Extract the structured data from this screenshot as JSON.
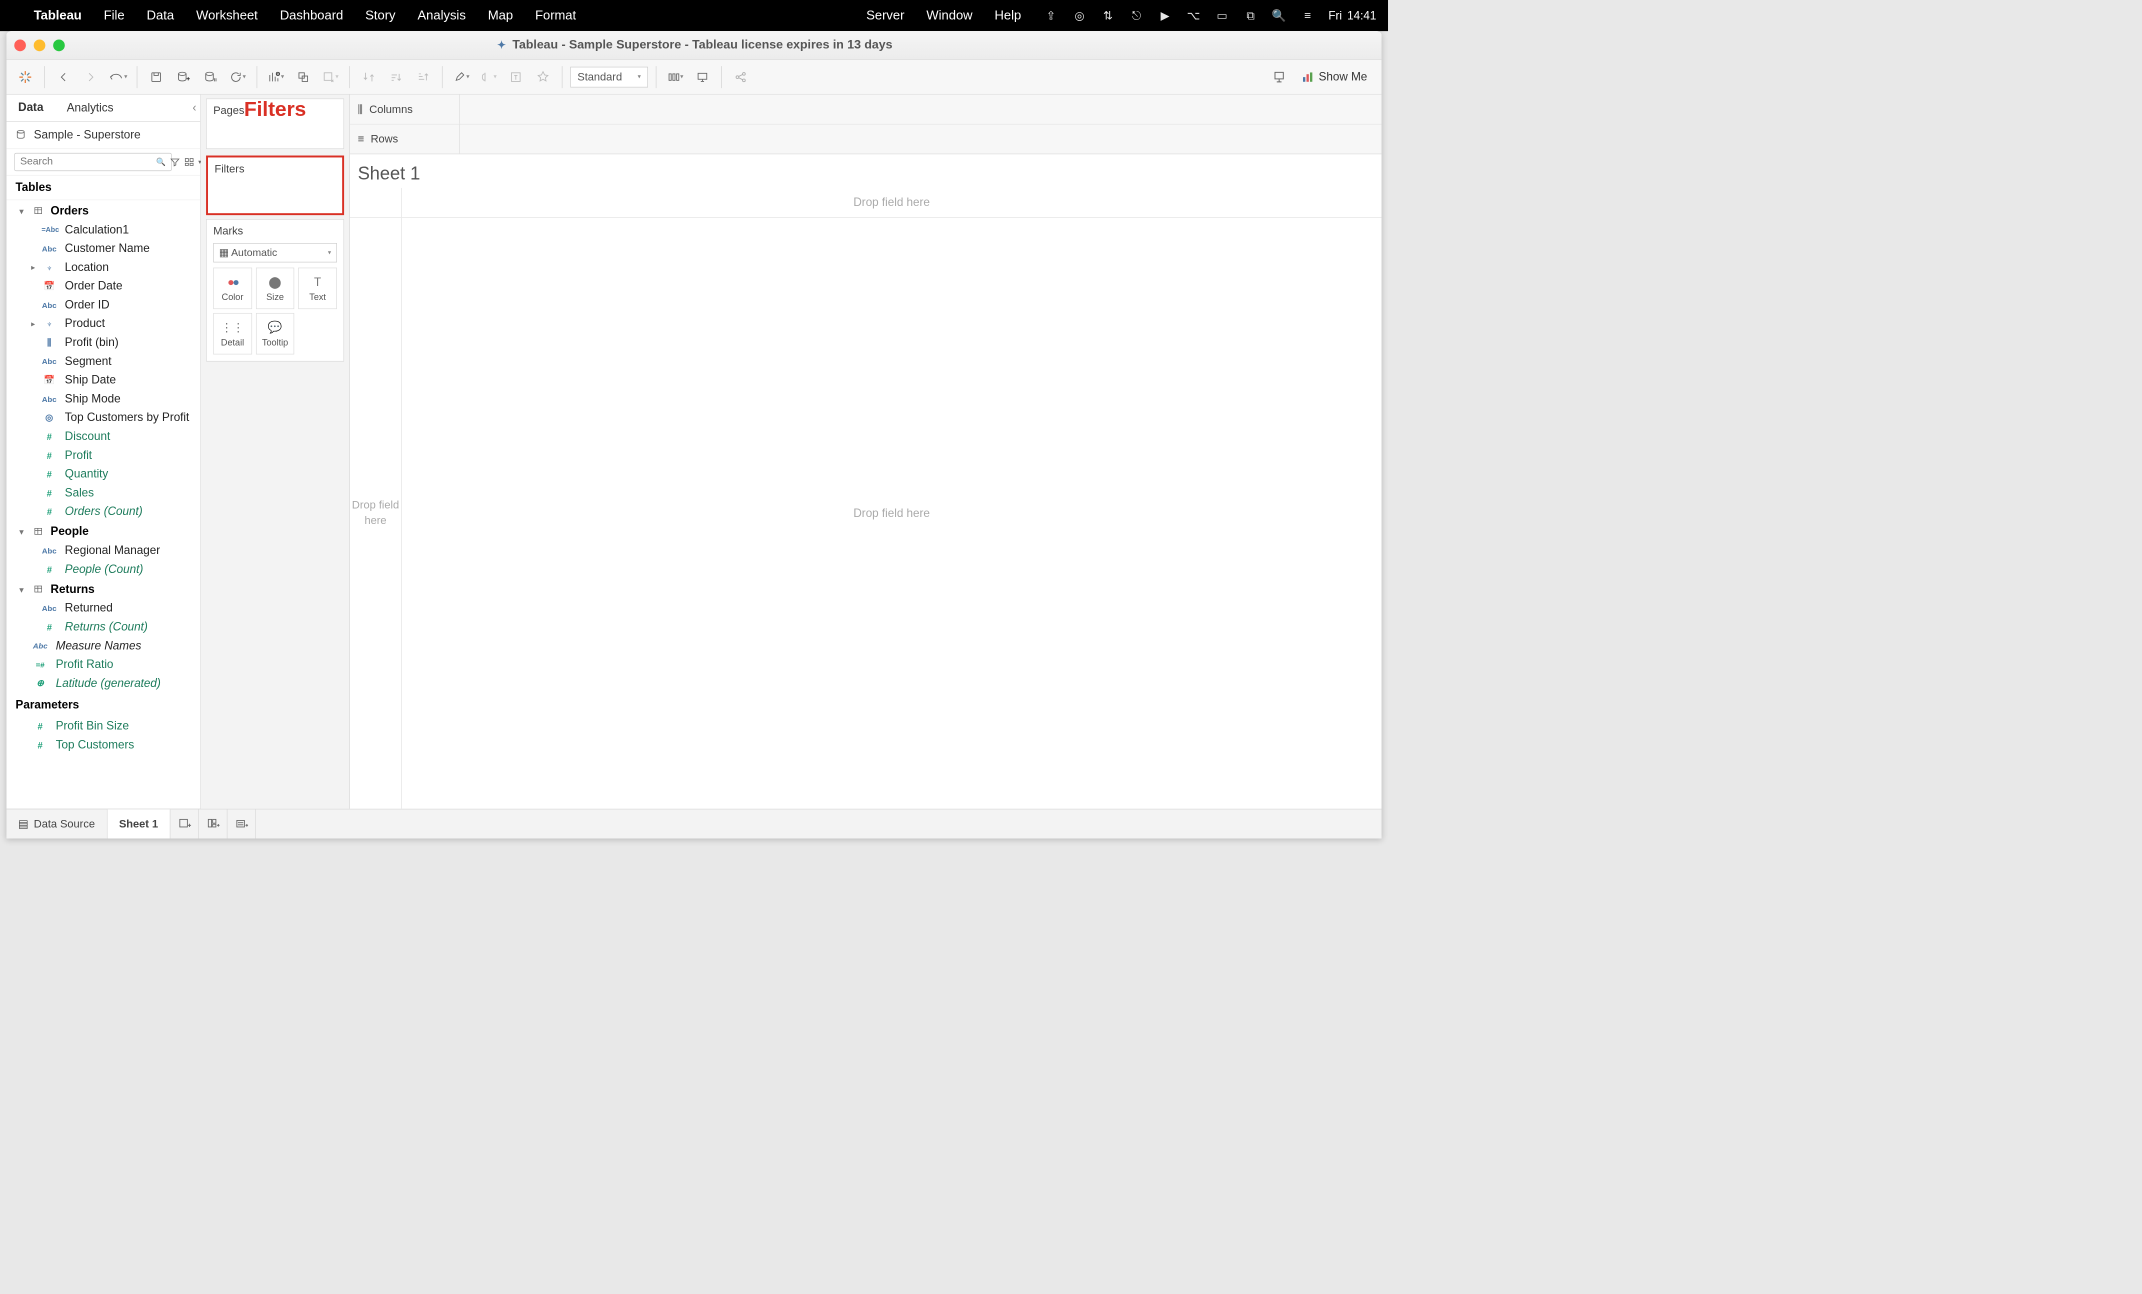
{
  "menubar": {
    "app": "Tableau",
    "items": [
      "File",
      "Data",
      "Worksheet",
      "Dashboard",
      "Story",
      "Analysis",
      "Map",
      "Format"
    ],
    "right_items": [
      "Server",
      "Window",
      "Help"
    ],
    "clock_day": "Fri",
    "clock_time": "14:41"
  },
  "window": {
    "title": "Tableau - Sample Superstore - Tableau license expires in 13 days"
  },
  "toolbar": {
    "fit": "Standard",
    "showme": "Show Me"
  },
  "data_pane": {
    "tabs": [
      "Data",
      "Analytics"
    ],
    "datasource": "Sample - Superstore",
    "search_placeholder": "Search",
    "tables_label": "Tables",
    "params_label": "Parameters",
    "tables": [
      {
        "name": "Orders",
        "fields": [
          {
            "label": "Calculation1",
            "icon": "=Abc",
            "kind": "dim"
          },
          {
            "label": "Customer Name",
            "icon": "Abc",
            "kind": "dim"
          },
          {
            "label": "Location",
            "icon": "hier",
            "kind": "dim",
            "expandable": true
          },
          {
            "label": "Order Date",
            "icon": "date",
            "kind": "dim"
          },
          {
            "label": "Order ID",
            "icon": "Abc",
            "kind": "dim"
          },
          {
            "label": "Product",
            "icon": "hier",
            "kind": "dim",
            "expandable": true
          },
          {
            "label": "Profit (bin)",
            "icon": "bin",
            "kind": "dim"
          },
          {
            "label": "Segment",
            "icon": "Abc",
            "kind": "dim"
          },
          {
            "label": "Ship Date",
            "icon": "date",
            "kind": "dim"
          },
          {
            "label": "Ship Mode",
            "icon": "Abc",
            "kind": "dim"
          },
          {
            "label": "Top Customers by Profit",
            "icon": "set",
            "kind": "dim"
          },
          {
            "label": "Discount",
            "icon": "#",
            "kind": "meas"
          },
          {
            "label": "Profit",
            "icon": "#",
            "kind": "meas"
          },
          {
            "label": "Quantity",
            "icon": "#",
            "kind": "meas"
          },
          {
            "label": "Sales",
            "icon": "#",
            "kind": "meas"
          },
          {
            "label": "Orders (Count)",
            "icon": "#",
            "kind": "meas",
            "italic": true
          }
        ]
      },
      {
        "name": "People",
        "fields": [
          {
            "label": "Regional Manager",
            "icon": "Abc",
            "kind": "dim"
          },
          {
            "label": "People (Count)",
            "icon": "#",
            "kind": "meas",
            "italic": true
          }
        ]
      },
      {
        "name": "Returns",
        "fields": [
          {
            "label": "Returned",
            "icon": "Abc",
            "kind": "dim"
          },
          {
            "label": "Returns (Count)",
            "icon": "#",
            "kind": "meas",
            "italic": true
          }
        ]
      }
    ],
    "loose_fields": [
      {
        "label": "Measure Names",
        "icon": "Abc",
        "kind": "dim",
        "italic": true
      },
      {
        "label": "Profit Ratio",
        "icon": "=#",
        "kind": "meas"
      },
      {
        "label": "Latitude (generated)",
        "icon": "globe",
        "kind": "meas",
        "italic": true
      }
    ],
    "parameters": [
      {
        "label": "Profit Bin Size",
        "icon": "#",
        "kind": "meas"
      },
      {
        "label": "Top Customers",
        "icon": "#",
        "kind": "meas"
      }
    ]
  },
  "shelves": {
    "pages": "Pages",
    "filters": "Filters",
    "filters_callout": "Filters",
    "marks": "Marks",
    "mark_type": "Automatic",
    "mark_cells": [
      "Color",
      "Size",
      "Text",
      "Detail",
      "Tooltip"
    ]
  },
  "view": {
    "columns": "Columns",
    "rows": "Rows",
    "sheet_title": "Sheet 1",
    "drop_col": "Drop field here",
    "drop_row": "Drop field here",
    "drop_body": "Drop field here"
  },
  "bottom": {
    "datasource": "Data Source",
    "sheet": "Sheet 1"
  }
}
